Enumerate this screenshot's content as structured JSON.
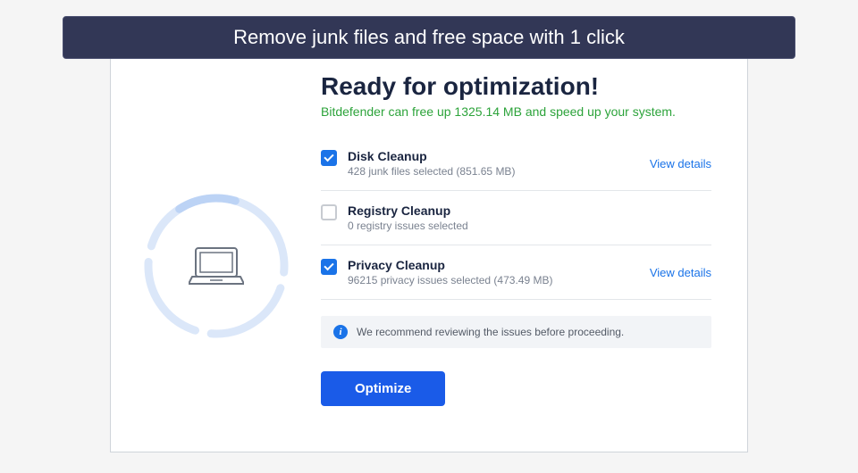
{
  "banner": {
    "text": "Remove junk files and free space with 1 click"
  },
  "heading": "Ready for optimization!",
  "subheading": "Bitdefender can free up 1325.14 MB and speed up your system.",
  "items": [
    {
      "title": "Disk Cleanup",
      "sub": "428 junk files selected (851.65 MB)",
      "checked": true,
      "details_label": "View details",
      "has_details": true
    },
    {
      "title": "Registry Cleanup",
      "sub": "0 registry issues selected",
      "checked": false,
      "has_details": false
    },
    {
      "title": "Privacy Cleanup",
      "sub": "96215 privacy issues selected (473.49 MB)",
      "checked": true,
      "details_label": "View details",
      "has_details": true
    }
  ],
  "recommendation": "We recommend reviewing the issues before proceeding.",
  "optimize_label": "Optimize"
}
